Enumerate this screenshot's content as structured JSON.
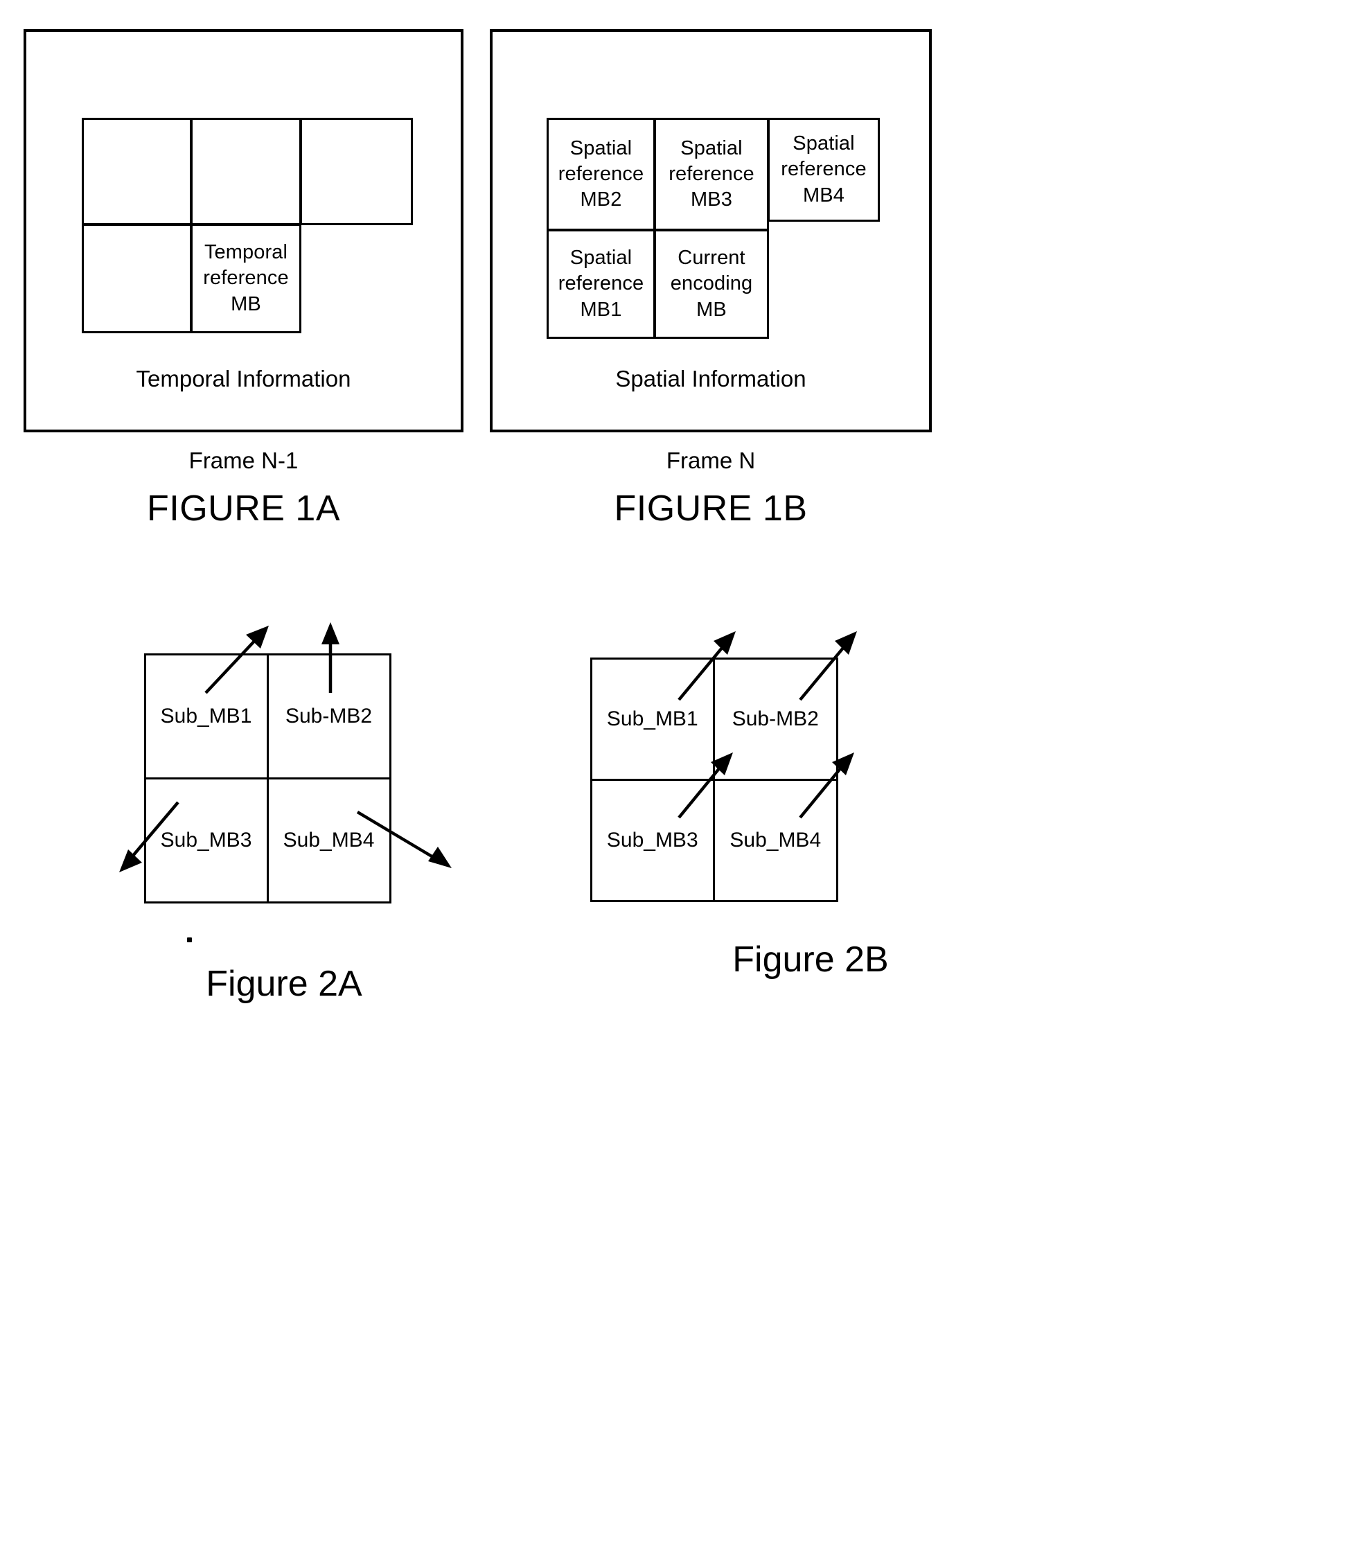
{
  "document": {
    "type": "patent-figure-sheet",
    "figures": [
      "FIGURE 1A",
      "FIGURE 1B",
      "Figure 2A",
      "Figure 2B"
    ]
  },
  "figure_1a": {
    "title": "FIGURE 1A",
    "frame_label": "Frame N-1",
    "panel_caption": "Temporal Information",
    "macroblocks": [
      {
        "id": "mb-top-left",
        "label": ""
      },
      {
        "id": "mb-top-center",
        "label": ""
      },
      {
        "id": "mb-top-right",
        "label": ""
      },
      {
        "id": "mb-bottom-left",
        "label": ""
      },
      {
        "id": "mb-temporal-reference",
        "label": "Temporal\nreference\nMB",
        "line1": "Temporal",
        "line2": "reference",
        "line3": "MB"
      }
    ]
  },
  "figure_1b": {
    "title": "FIGURE 1B",
    "frame_label": "Frame N",
    "panel_caption": "Spatial Information",
    "macroblocks": [
      {
        "id": "mb-spatial-reference-2",
        "line1": "Spatial",
        "line2": "reference",
        "line3": "MB2"
      },
      {
        "id": "mb-spatial-reference-3",
        "line1": "Spatial",
        "line2": "reference",
        "line3": "MB3"
      },
      {
        "id": "mb-spatial-reference-4",
        "line1": "Spatial",
        "line2": "reference",
        "line3": "MB4"
      },
      {
        "id": "mb-spatial-reference-1",
        "line1": "Spatial",
        "line2": "reference",
        "line3": "MB1"
      },
      {
        "id": "mb-current-encoding",
        "line1": "Current",
        "line2": "encoding",
        "line3": "MB"
      }
    ]
  },
  "figure_2a": {
    "title": "Figure 2A",
    "sub_macroblocks": [
      {
        "id": "sub-mb-1",
        "label": "Sub_MB1"
      },
      {
        "id": "sub-mb-2",
        "label": "Sub-MB2"
      },
      {
        "id": "sub-mb-3",
        "label": "Sub_MB3"
      },
      {
        "id": "sub-mb-4",
        "label": "Sub_MB4"
      }
    ],
    "motion_vectors": [
      {
        "for": "sub-mb-1",
        "direction": "up-right",
        "description": "diverging motion vector pointing up and to the right"
      },
      {
        "for": "sub-mb-2",
        "direction": "up",
        "description": "motion vector pointing straight up"
      },
      {
        "for": "sub-mb-3",
        "direction": "down-left",
        "description": "motion vector pointing down and to the left"
      },
      {
        "for": "sub-mb-4",
        "direction": "down-right",
        "description": "motion vector pointing down and to the right"
      }
    ],
    "pattern": "divergent"
  },
  "figure_2b": {
    "title": "Figure 2B",
    "sub_macroblocks": [
      {
        "id": "sub-mb-1",
        "label": "Sub_MB1"
      },
      {
        "id": "sub-mb-2",
        "label": "Sub-MB2"
      },
      {
        "id": "sub-mb-3",
        "label": "Sub_MB3"
      },
      {
        "id": "sub-mb-4",
        "label": "Sub_MB4"
      }
    ],
    "motion_vectors": [
      {
        "for": "sub-mb-1",
        "direction": "up-right",
        "description": "motion vector pointing up and to the right"
      },
      {
        "for": "sub-mb-2",
        "direction": "up-right",
        "description": "motion vector pointing up and to the right"
      },
      {
        "for": "sub-mb-3",
        "direction": "up-right",
        "description": "motion vector pointing up and to the right"
      },
      {
        "for": "sub-mb-4",
        "direction": "up-right",
        "description": "motion vector pointing up and to the right"
      }
    ],
    "pattern": "uniform"
  },
  "colors": {
    "ink": "#000000",
    "paper": "#ffffff"
  }
}
